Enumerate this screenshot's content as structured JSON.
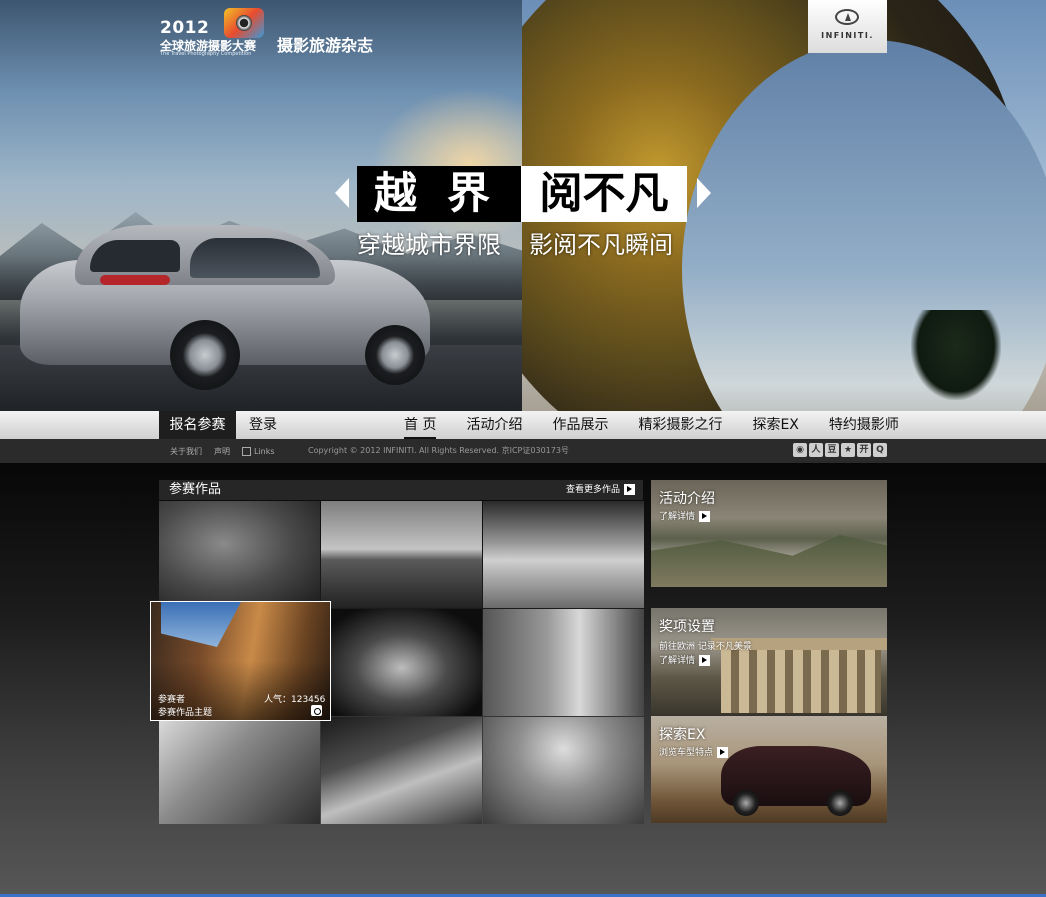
{
  "hero": {
    "contest_year": "2012",
    "contest_name": "全球旅游摄影大赛",
    "contest_name_en": "The Travel Photography Competition",
    "magazine": "摄影旅游杂志",
    "brand": "INFINITI.",
    "headline_left": "越界",
    "headline_right": "阅不凡",
    "subline_left": "穿越城市界限",
    "subline_right": "影阅不凡瞬间"
  },
  "nav": {
    "register": "报名参赛",
    "login": "登录",
    "items": [
      "首 页",
      "活动介绍",
      "作品展示",
      "精彩摄影之行",
      "探索EX",
      "特约摄影师"
    ]
  },
  "subbar": {
    "about": "关于我们",
    "statement": "声明",
    "links": "Links",
    "copyright": "Copyright © 2012  INFINITI. All Rights Reserved.   京ICP证030173号",
    "social_icons": [
      "sohu-icon",
      "renren-icon",
      "douban-icon",
      "star-icon",
      "kaixin-icon",
      "qq-icon"
    ]
  },
  "works": {
    "title": "参赛作品",
    "more": "查看更多作品",
    "featured": {
      "author": "参赛者",
      "title": "参赛作品主题",
      "popularity": "人气：123456"
    }
  },
  "side": {
    "activity": {
      "title": "活动介绍",
      "link": "了解详情"
    },
    "awards": {
      "title": "奖项设置",
      "desc": "前往欧洲 记录不凡美景",
      "link": "了解详情"
    },
    "explore": {
      "title": "探索EX",
      "link": "浏览车型特点"
    }
  },
  "colors": {
    "accent_line": "#3b72c7",
    "nav_active_bg": "#1e1e1e"
  }
}
